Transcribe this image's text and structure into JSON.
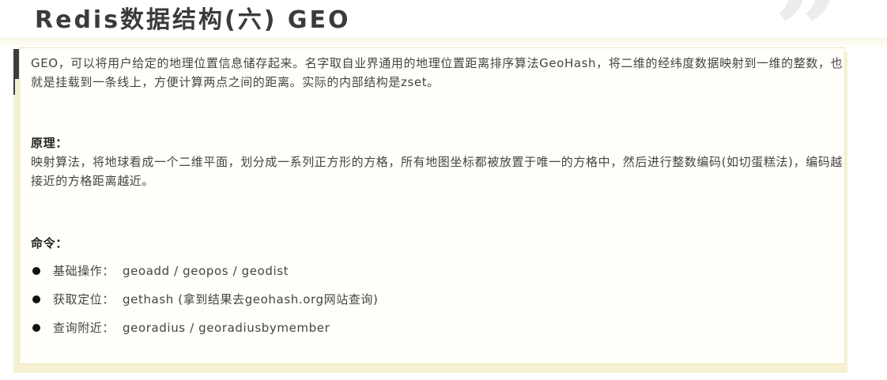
{
  "page": {
    "title": "Redis数据结构(六) GEO",
    "quote_mark": "”"
  },
  "card": {
    "intro": "GEO，可以将用户给定的地理位置信息储存起来。名字取自业界通用的地理位置距离排序算法GeoHash，将二维的经纬度数据映射到一维的整数，也就是挂载到一条线上，方便计算两点之间的距离。实际的内部结构是zset。",
    "principle_heading": "原理：",
    "principle_text": "映射算法，将地球看成一个二维平面，划分成一系列正方形的方格，所有地图坐标都被放置于唯一的方格中，然后进行整数编码(如切蛋糕法)，编码越接近的方格距离越近。",
    "commands_heading": "命令：",
    "commands": [
      {
        "name": "基础操作：",
        "value": "geoadd / geopos / geodist"
      },
      {
        "name": "获取定位：",
        "value": "gethash (拿到结果去geohash.org网站查询)"
      },
      {
        "name": "查询附近：",
        "value": "georadius / georadiusbymember"
      }
    ]
  },
  "colors": {
    "card_background": "#fffef8",
    "card_shadow": "#f5f0cf",
    "accent_bar": "#3a3d44"
  }
}
